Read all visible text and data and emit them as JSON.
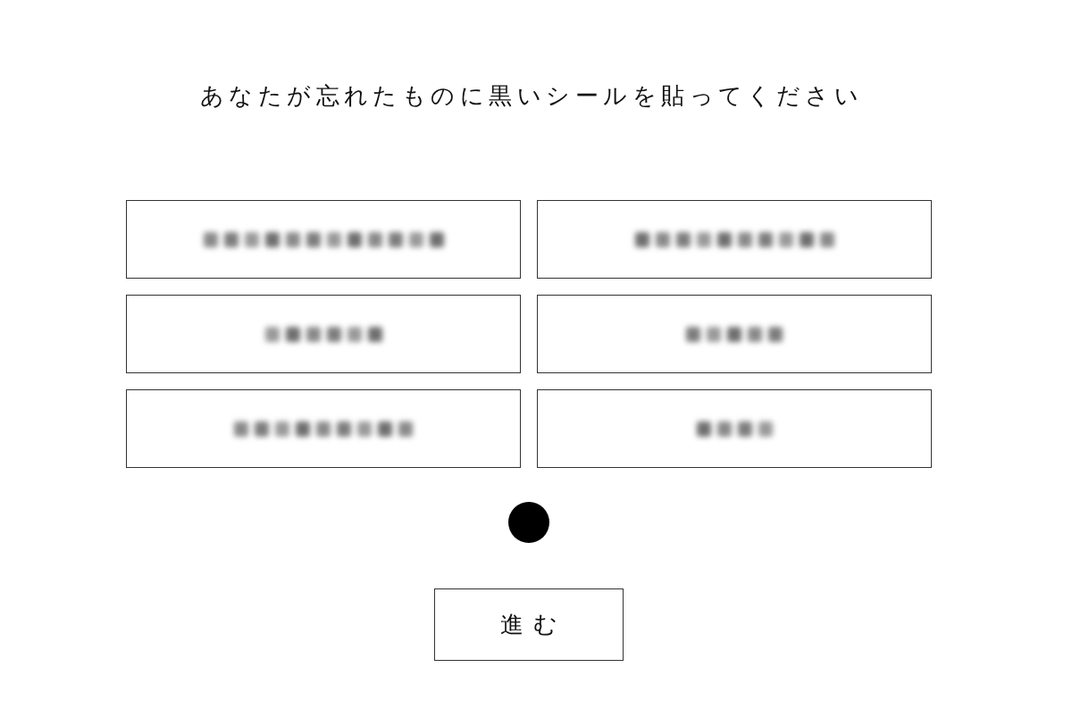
{
  "title": "あなたが忘れたものに黒いシールを貼ってください",
  "options": [
    {
      "kind": "blurred"
    },
    {
      "kind": "blurred"
    },
    {
      "kind": "blurred"
    },
    {
      "kind": "blurred"
    },
    {
      "kind": "blurred"
    },
    {
      "kind": "blurred"
    }
  ],
  "next_button": {
    "label": "進む"
  }
}
